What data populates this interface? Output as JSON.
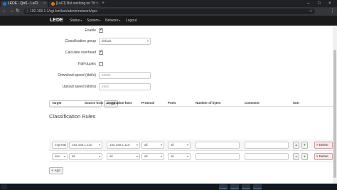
{
  "browser": {
    "tabs": [
      {
        "title": "LEDE - QoS - LuCI",
        "favicon_color": "#1a73e8"
      },
      {
        "title": "[LuCI] Not working on Th",
        "favicon_color": "#e8710a"
      }
    ],
    "url": "192.168.1.1/cgi-bin/luci/admin/network/qos",
    "new_tab_glyph": "+",
    "window_controls": [
      "–",
      "□",
      "×"
    ]
  },
  "app": {
    "brand": "LEDE",
    "nav": [
      {
        "label": "Status"
      },
      {
        "label": "System"
      },
      {
        "label": "Network"
      },
      {
        "label": "Logout"
      }
    ]
  },
  "settings_form": {
    "enable": {
      "label": "Enable",
      "checked": true
    },
    "classification_group": {
      "label": "Classification group",
      "value": "default"
    },
    "calculate_overhead": {
      "label": "Calculate overhead",
      "checked": true
    },
    "half_duplex": {
      "label": "Half-duplex",
      "checked": false
    },
    "download_speed": {
      "label": "Download speed (kbit/s)",
      "placeholder": "10000"
    },
    "upload_speed": {
      "label": "Upload speed (kbit/s)",
      "placeholder": "2500"
    },
    "add_button_label": "Add"
  },
  "classification_rules": {
    "title": "Classification Rules",
    "columns": [
      "Target",
      "Source host",
      "Destination host",
      "Protocol",
      "Ports",
      "Number of bytes",
      "Comment",
      "Sort"
    ],
    "rows": [
      {
        "target": "express",
        "source_host": "192.168.1.110",
        "destination_host": "192.168.1.110",
        "protocol": "all",
        "ports": "all",
        "bytes": "",
        "comment": ""
      },
      {
        "target": "low",
        "source_host": "all",
        "destination_host": "all",
        "protocol": "all",
        "ports": "all",
        "bytes": "",
        "comment": ""
      }
    ],
    "delete_label": "Delete",
    "add_label": "Add"
  },
  "taskbar": {
    "items_count": 4
  }
}
